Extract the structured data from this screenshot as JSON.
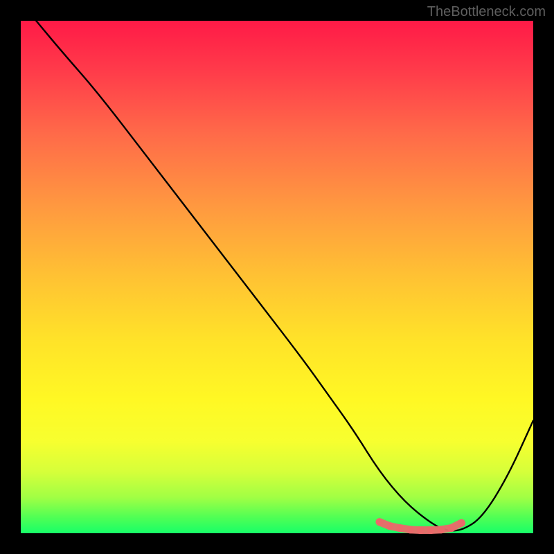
{
  "watermark": "TheBottleneck.com",
  "chart_data": {
    "type": "line",
    "title": "",
    "xlabel": "",
    "ylabel": "",
    "x_range": [
      0,
      100
    ],
    "y_range": [
      0,
      100
    ],
    "background": "rainbow-gradient-vertical",
    "grid": false,
    "series": [
      {
        "name": "bottleneck-curve",
        "color": "#000000",
        "x": [
          3,
          8,
          15,
          25,
          35,
          45,
          55,
          60,
          65,
          70,
          75,
          80,
          83,
          86,
          90,
          95,
          100
        ],
        "y": [
          100,
          94,
          86,
          73,
          60,
          47,
          34,
          27,
          20,
          12,
          6,
          2,
          0.5,
          0.5,
          3,
          11,
          22
        ]
      },
      {
        "name": "highlight-zone",
        "color": "#ea6a6a",
        "type": "scatter",
        "x": [
          70,
          72,
          74,
          76,
          78,
          80,
          82,
          84,
          86
        ],
        "y": [
          2.2,
          1.4,
          1.0,
          0.7,
          0.6,
          0.6,
          0.7,
          1.0,
          2.0
        ]
      }
    ],
    "annotations": []
  }
}
